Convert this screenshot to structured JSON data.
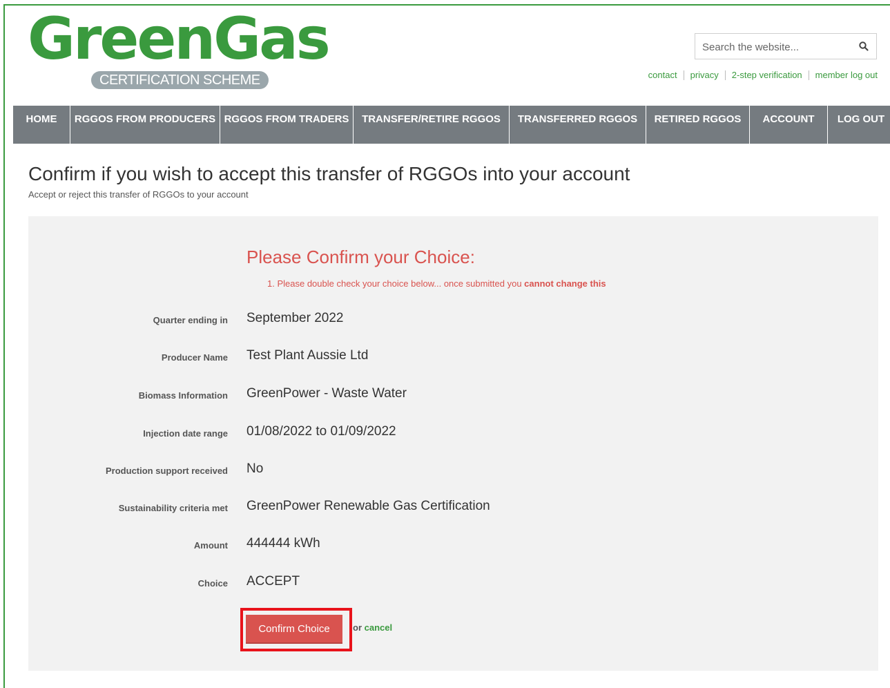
{
  "header": {
    "logo_text": "GreenGas",
    "logo_subtitle": "CERTIFICATION SCHEME",
    "search_placeholder": "Search the website...",
    "util_links": [
      "contact",
      "privacy",
      "2-step verification",
      "member log out"
    ]
  },
  "nav": [
    {
      "label": "HOME"
    },
    {
      "label": "RGGOS FROM PRODUCERS"
    },
    {
      "label": "RGGOS FROM TRADERS"
    },
    {
      "label": "TRANSFER/RETIRE RGGOS"
    },
    {
      "label": "TRANSFERRED RGGOS"
    },
    {
      "label": "RETIRED RGGOS"
    },
    {
      "label": "ACCOUNT"
    },
    {
      "label": "LOG OUT"
    }
  ],
  "page": {
    "title": "Confirm if you wish to accept this transfer of RGGOs into your account",
    "subtitle": "Accept or reject this transfer of RGGOs to your account"
  },
  "confirm": {
    "heading": "Please Confirm your Choice:",
    "note_prefix": "1. Please double check your choice below... once submitted you ",
    "note_strong": "cannot change this",
    "fields": [
      {
        "label": "Quarter ending in",
        "value": "September 2022"
      },
      {
        "label": "Producer Name",
        "value": "Test Plant Aussie Ltd"
      },
      {
        "label": "Biomass Information",
        "value": "GreenPower - Waste Water"
      },
      {
        "label": "Injection date range",
        "value": "01/08/2022 to 01/09/2022"
      },
      {
        "label": "Production support received",
        "value": "No"
      },
      {
        "label": "Sustainability criteria met",
        "value": "GreenPower Renewable Gas Certification"
      },
      {
        "label": "Amount",
        "value": "444444 kWh"
      },
      {
        "label": "Choice",
        "value": "ACCEPT"
      }
    ],
    "button_label": "Confirm Choice",
    "or_text": "or ",
    "cancel_label": "cancel"
  },
  "colors": {
    "brand_green": "#3a9a3e",
    "nav_bg": "#757b80",
    "accent_red": "#d9534f",
    "highlight_border": "#e8131b"
  }
}
